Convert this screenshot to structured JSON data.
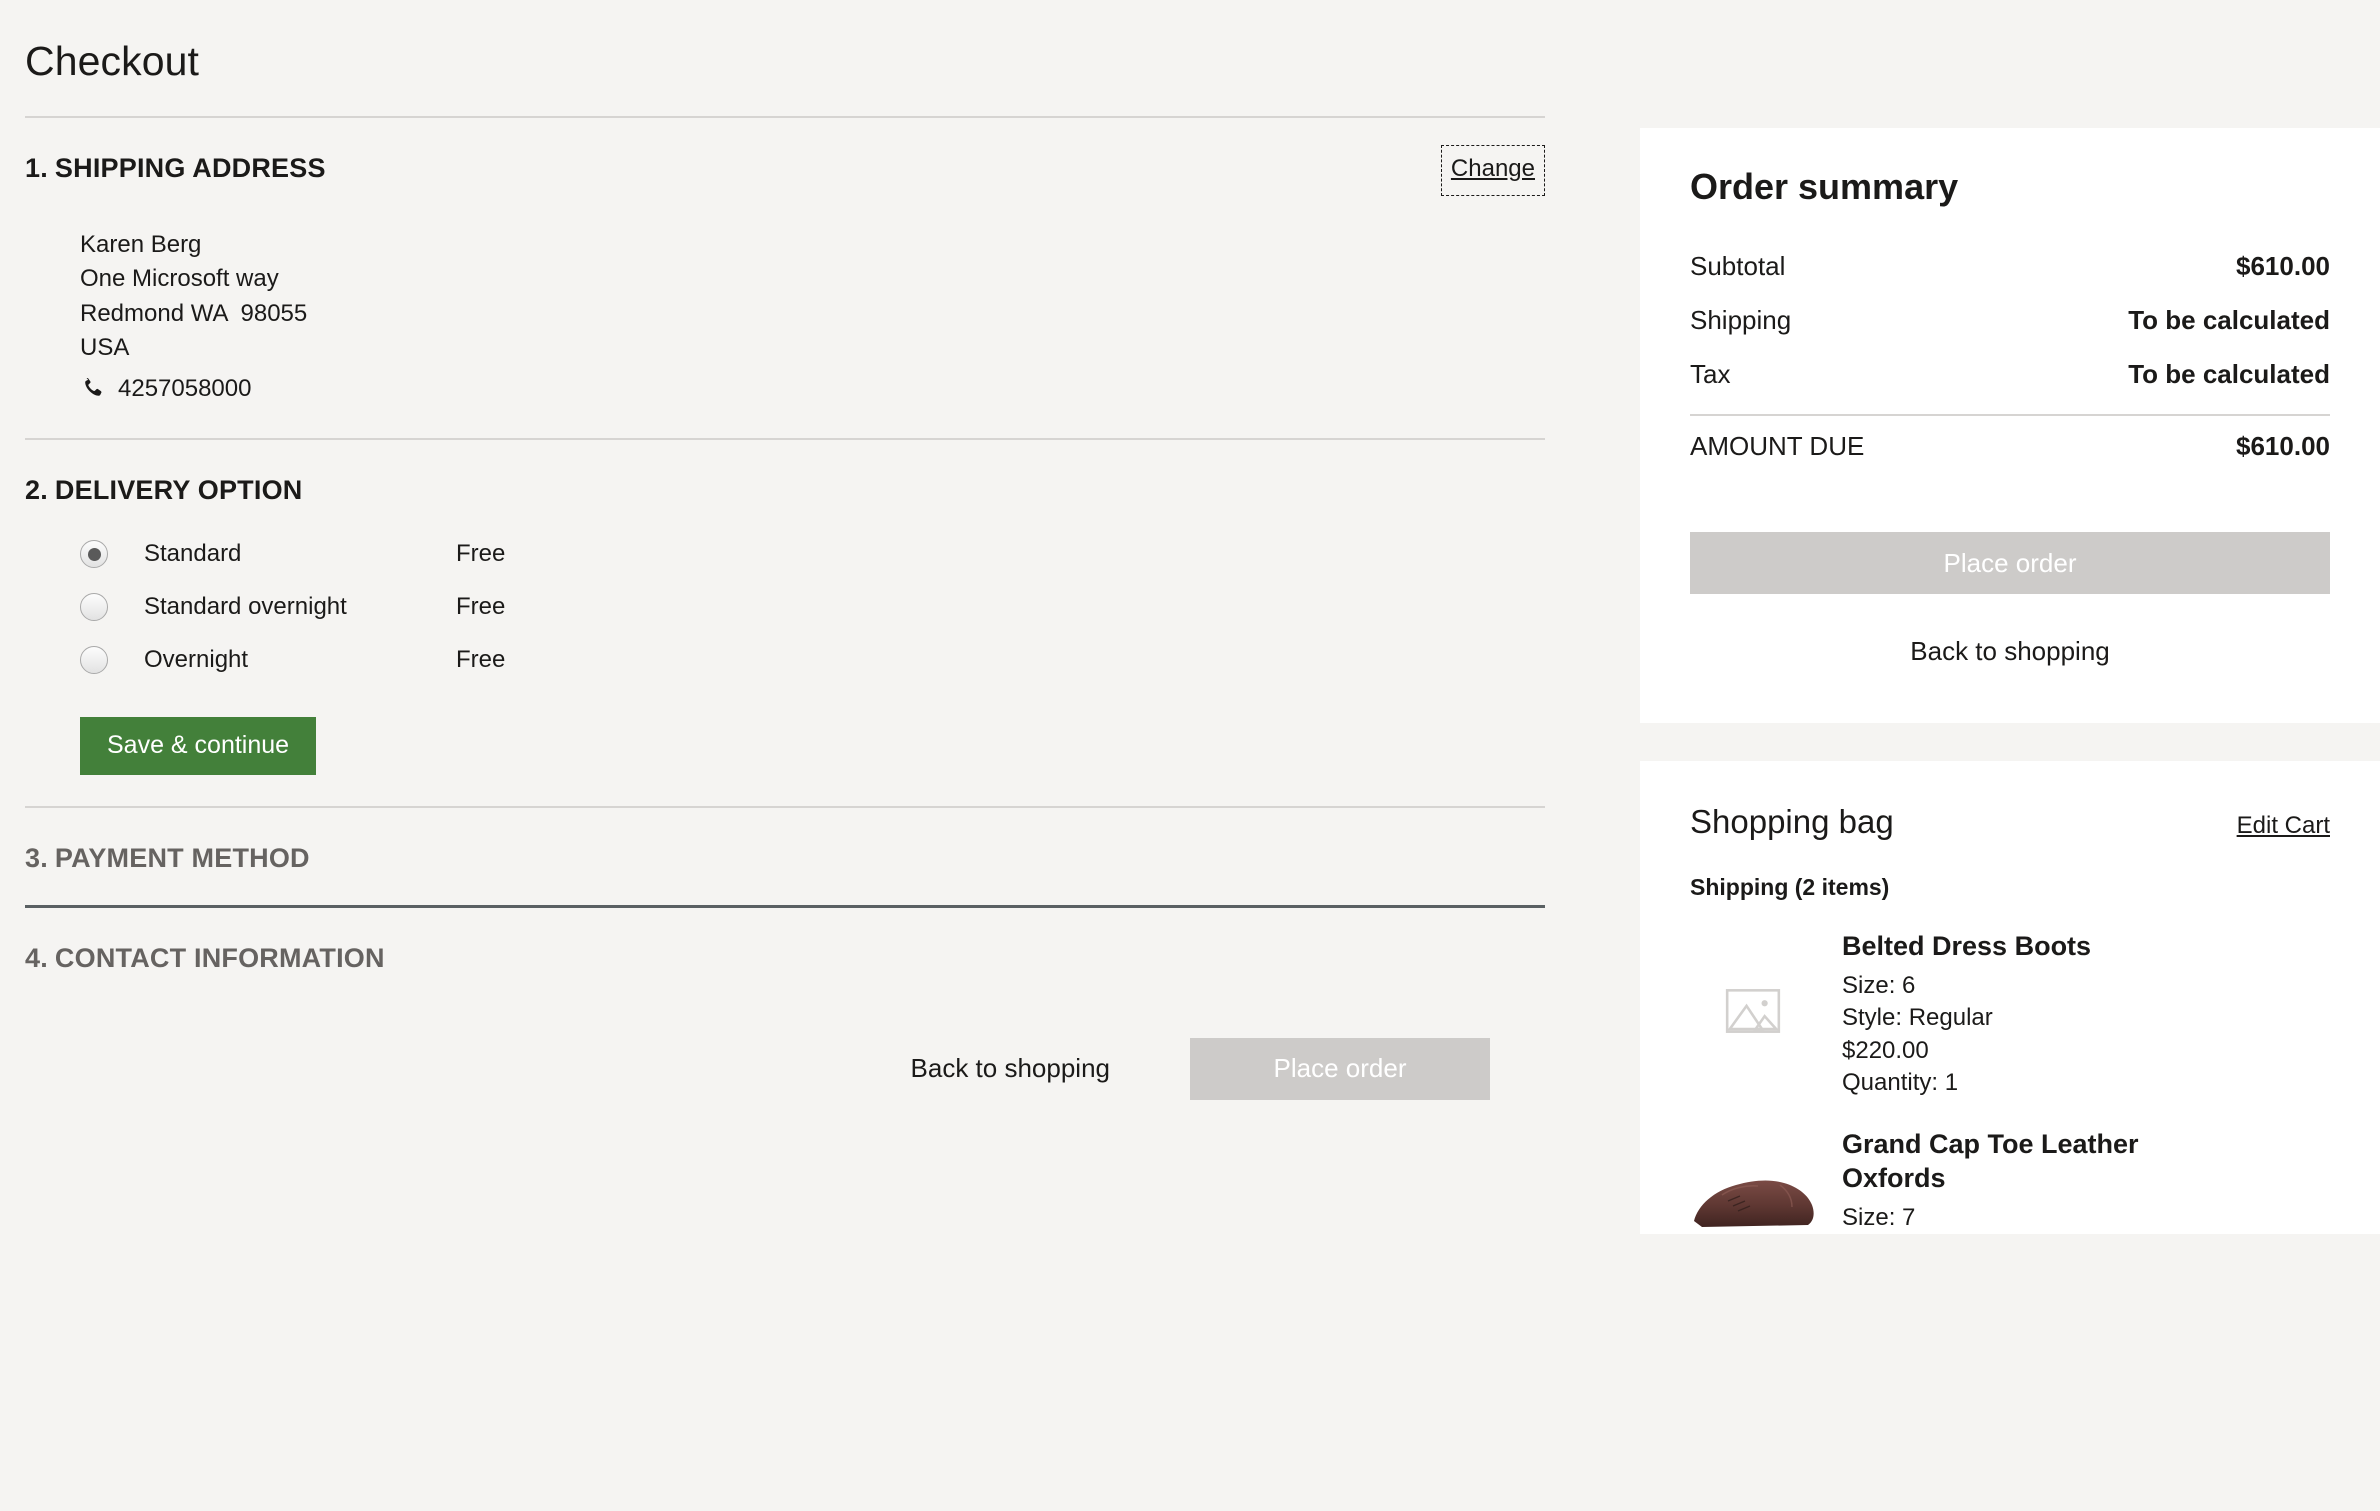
{
  "header": {
    "title": "Checkout"
  },
  "shipping_address": {
    "step_number": "1.",
    "title": "SHIPPING ADDRESS",
    "change_label": "Change",
    "name": "Karen Berg",
    "street": "One Microsoft way",
    "city_state_zip": "Redmond WA  98055",
    "country": "USA",
    "phone": "4257058000",
    "phone_icon": "phone-icon"
  },
  "delivery_option": {
    "step_number": "2.",
    "title": "DELIVERY OPTION",
    "options": [
      {
        "label": "Standard",
        "price": "Free",
        "selected": true
      },
      {
        "label": "Standard overnight",
        "price": "Free",
        "selected": false
      },
      {
        "label": "Overnight",
        "price": "Free",
        "selected": false
      }
    ],
    "save_label": "Save & continue"
  },
  "payment_method": {
    "step_number": "3.",
    "title": "PAYMENT METHOD"
  },
  "contact_information": {
    "step_number": "4.",
    "title": "CONTACT INFORMATION"
  },
  "bottom_actions": {
    "back_label": "Back to shopping",
    "place_order_label": "Place order"
  },
  "order_summary": {
    "title": "Order summary",
    "rows": [
      {
        "label": "Subtotal",
        "value": "$610.00"
      },
      {
        "label": "Shipping",
        "value": "To be calculated"
      },
      {
        "label": "Tax",
        "value": "To be calculated"
      }
    ],
    "total_label": "AMOUNT DUE",
    "total_value": "$610.00",
    "place_order_label": "Place order",
    "back_label": "Back to shopping"
  },
  "shopping_bag": {
    "title": "Shopping bag",
    "edit_label": "Edit Cart",
    "group_label": "Shipping (2 items)",
    "items": [
      {
        "name": "Belted Dress Boots",
        "size": "Size: 6",
        "style": "Style: Regular",
        "price": "$220.00",
        "quantity": "Quantity: 1",
        "image": "image-placeholder-icon"
      },
      {
        "name": "Grand Cap Toe Leather Oxfords",
        "size": "Size: 7",
        "image": "oxford-shoe-photo"
      }
    ]
  },
  "colors": {
    "page_background": "#f5f4f2",
    "card_background": "#ffffff",
    "primary_button": "#43803a",
    "disabled_button": "#cdcbc9",
    "divider_light": "#d6d4d2",
    "divider_dark": "#5a6063",
    "inactive_text": "#666361"
  }
}
